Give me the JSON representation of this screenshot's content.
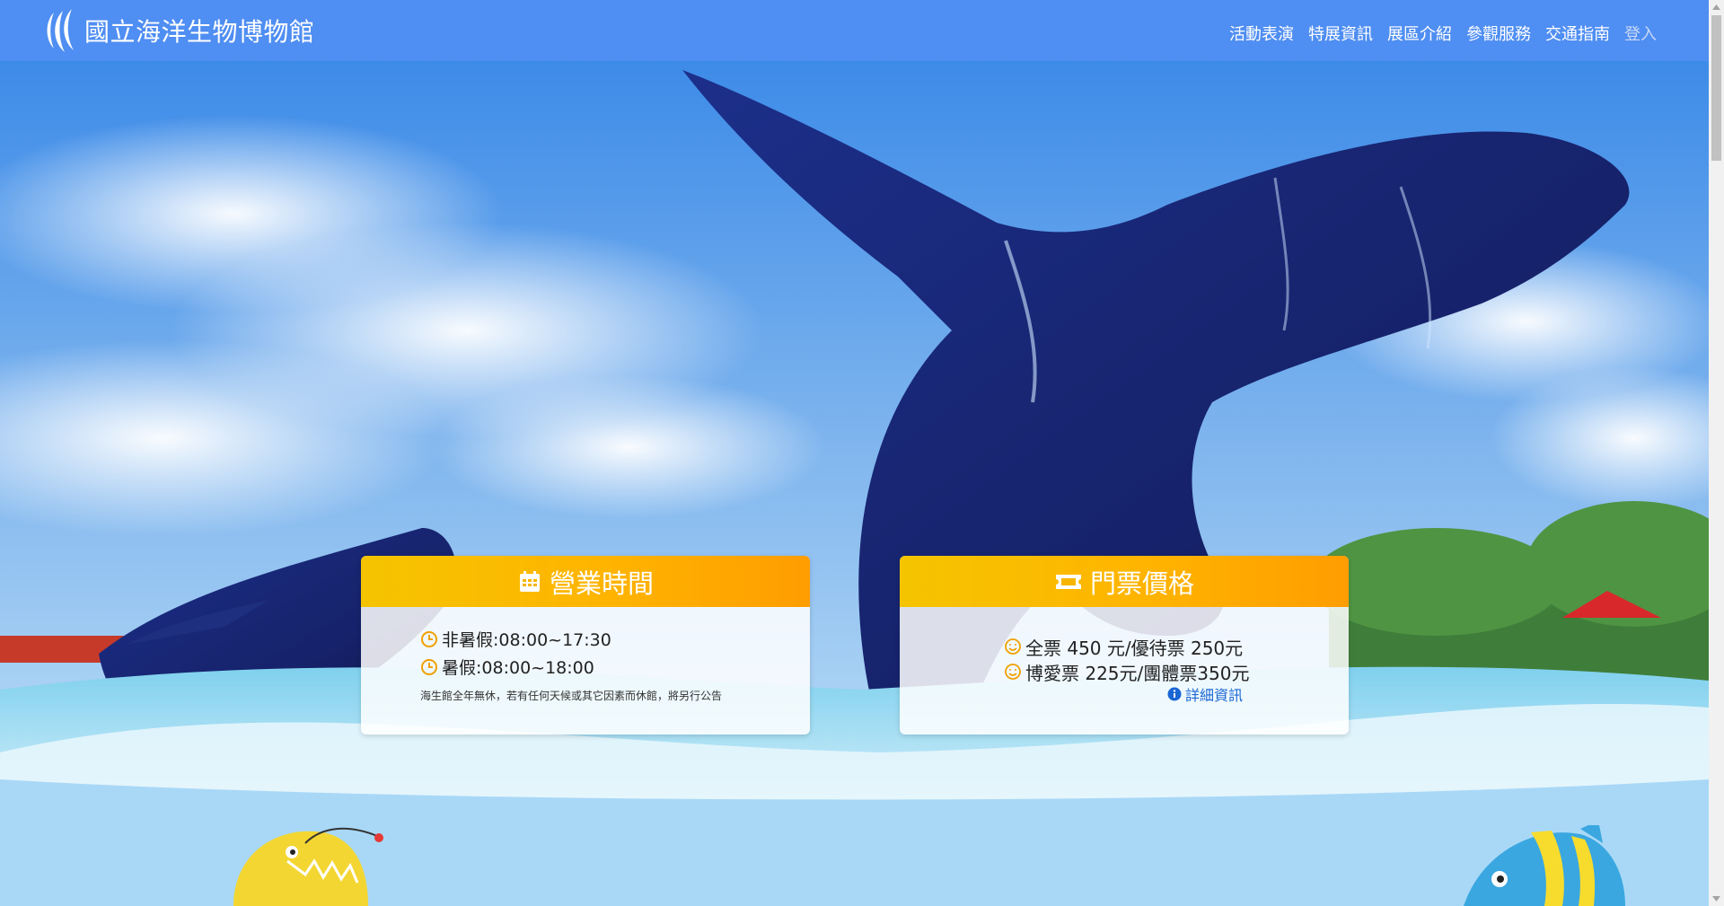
{
  "nav": {
    "brand": "國立海洋生物博物館",
    "items": [
      {
        "label": "活動表演"
      },
      {
        "label": "特展資訊"
      },
      {
        "label": "展區介紹"
      },
      {
        "label": "參觀服務"
      },
      {
        "label": "交通指南"
      },
      {
        "label": "登入"
      }
    ]
  },
  "hours_card": {
    "title": "營業時間",
    "icon": "calendar-icon",
    "lines": [
      {
        "icon": "clock-icon",
        "text": "非暑假:08:00~17:30"
      },
      {
        "icon": "clock-icon",
        "text": "暑假:08:00~18:00"
      }
    ],
    "note": "海生館全年無休，若有任何天候或其它因素而休館，將另行公告"
  },
  "price_card": {
    "title": "門票價格",
    "icon": "ticket-icon",
    "lines": [
      {
        "icon": "smile-icon",
        "text": "全票 450 元/優待票 250元"
      },
      {
        "icon": "smile-icon",
        "text": "博愛票 225元/團體票350元"
      }
    ],
    "details_link": "詳細資訊"
  },
  "colors": {
    "navbar": "#4f8ef2",
    "card_header_start": "#f5c400",
    "card_header_end": "#ff9d00",
    "link": "#1a66d4",
    "lower_band": "#a9d8f7"
  }
}
